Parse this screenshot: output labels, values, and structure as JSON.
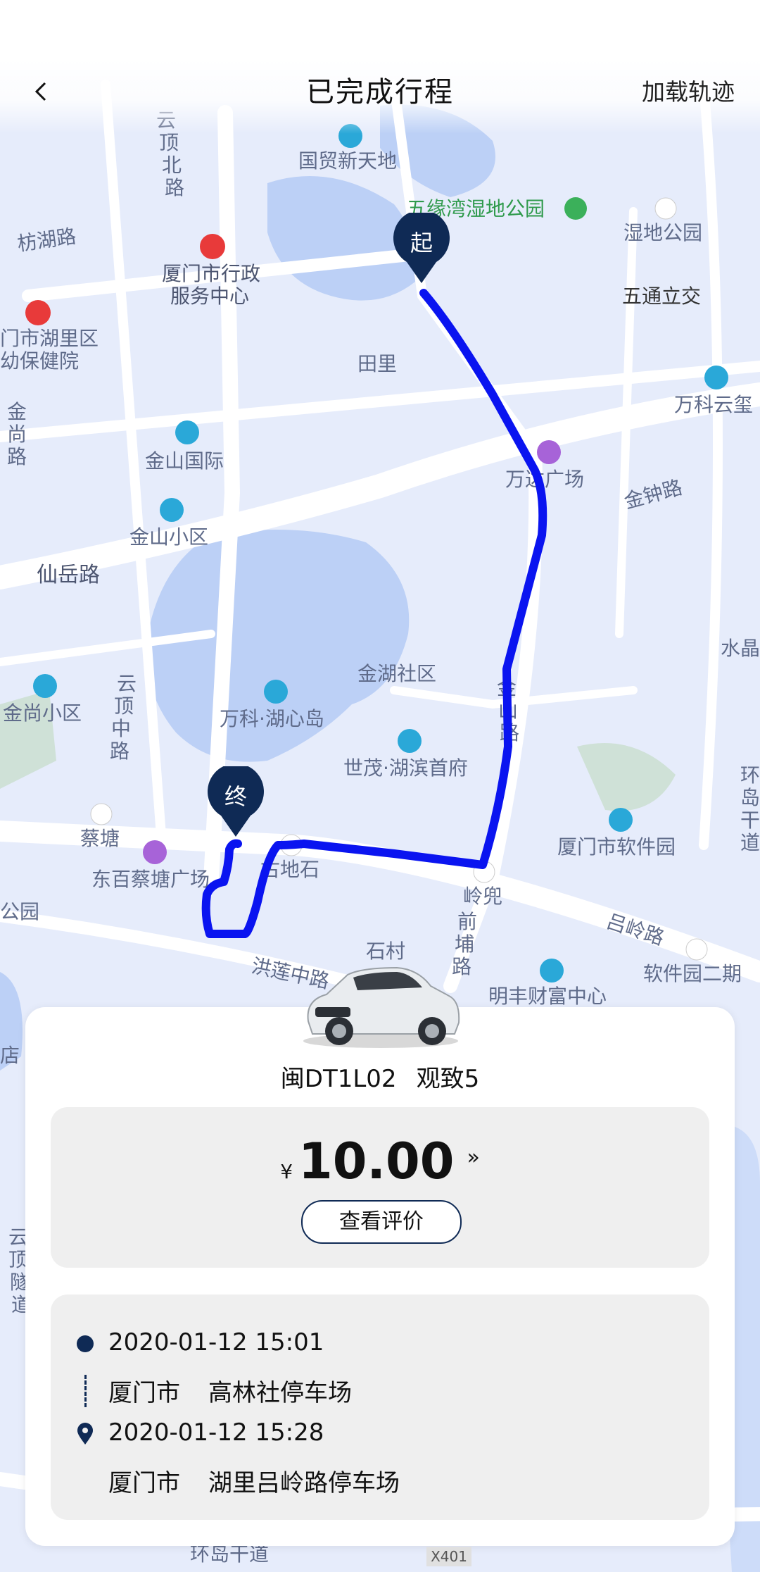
{
  "header": {
    "title": "已完成行程",
    "action_label": "加载轨迹",
    "back_icon": "chevron-left-icon"
  },
  "map": {
    "labels": {
      "yunding_north_rd": "云顶北路",
      "guomao": "国贸新天地",
      "wuyuanwan": "五缘湾湿地公园",
      "wetland_park": "湿地公园",
      "wutong": "五通立交",
      "fanghu_rd": "枋湖路",
      "gov_center": "厦门市行政服务中心",
      "hospital": "门市湖里区幼保健院",
      "tianli": "田里",
      "jinshang_rd": "金尚路",
      "wanke_yunxi": "万科云玺",
      "jinshan_intl": "金山国际",
      "wanda": "万达广场",
      "jinzhong_rd": "金钟路",
      "jinshan_xiaoqu": "金山小区",
      "xianyue_rd": "仙岳路",
      "shuijing": "水晶",
      "jinhu_community": "金湖社区",
      "jinshan_rd": "金山路",
      "jinshang_xiaoqu": "金尚小区",
      "wanke_hu": "万科·湖心岛",
      "yunding_mid_rd": "云顶中路",
      "shimao": "世茂·湖滨首府",
      "huandao": "环岛干道",
      "caitang": "蔡塘",
      "dongbai": "东百蔡塘广场",
      "gudishi": "古地石",
      "lingdou": "岭兜",
      "software_park": "厦门市软件园",
      "park_left": "公园",
      "shicun": "石村",
      "lvling_rd": "吕岭路",
      "software_2": "软件园二期",
      "honglian_rd": "洪莲中路",
      "qianpu_rd": "前埔路",
      "mingfeng": "明丰财富中心",
      "dian": "店",
      "yunding_tunnel": "云顶隧道",
      "huandao_bottom": "环岛干道",
      "x401": "X401"
    },
    "start_marker": "起",
    "end_marker": "终",
    "route_color": "#0a14f0"
  },
  "vehicle": {
    "plate": "闽DT1L02",
    "model": "观致5"
  },
  "fare": {
    "currency": "¥",
    "amount": "10.00",
    "chevron": "»",
    "review_button": "查看评价"
  },
  "trip": {
    "start_time": "2020-01-12 15:01",
    "start_city": "厦门市",
    "start_place": "高林社停车场",
    "end_time": "2020-01-12 15:28",
    "end_city": "厦门市",
    "end_place": "湖里吕岭路停车场"
  }
}
